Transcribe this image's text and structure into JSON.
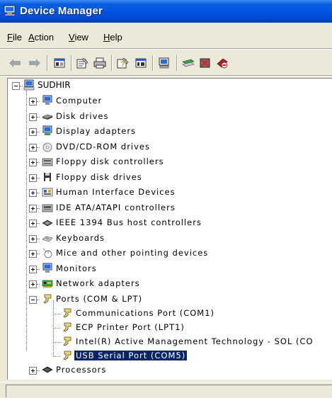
{
  "window": {
    "title": "Device Manager",
    "title_icon": "computer-icon"
  },
  "menu": [
    {
      "label": "File",
      "key": "F",
      "rest": "ile"
    },
    {
      "label": "Action",
      "key": "A",
      "rest": "ction"
    },
    {
      "label": "View",
      "key": "V",
      "rest": "iew"
    },
    {
      "label": "Help",
      "key": "H",
      "rest": "elp"
    }
  ],
  "toolbar": [
    "back-arrow-icon",
    "forward-arrow-icon",
    "show-hide-tree-icon",
    "properties-icon",
    "print-icon",
    "help-icon",
    "view-icon",
    "scan-hardware-icon",
    "update-driver-icon",
    "uninstall-icon",
    "disable-icon"
  ],
  "tree": {
    "root": "SUDHIR",
    "categories": [
      {
        "label": "Computer",
        "icon": "computer-monitor-icon"
      },
      {
        "label": "Disk drives",
        "icon": "disk-drive-icon"
      },
      {
        "label": "Display adapters",
        "icon": "display-adapter-icon"
      },
      {
        "label": "DVD/CD-ROM drives",
        "icon": "cdrom-icon"
      },
      {
        "label": "Floppy disk controllers",
        "icon": "floppy-controller-icon"
      },
      {
        "label": "Floppy disk drives",
        "icon": "floppy-drive-icon"
      },
      {
        "label": "Human Interface Devices",
        "icon": "hid-icon"
      },
      {
        "label": "IDE ATA/ATAPI controllers",
        "icon": "ide-controller-icon"
      },
      {
        "label": "IEEE 1394 Bus host controllers",
        "icon": "ieee1394-icon"
      },
      {
        "label": "Keyboards",
        "icon": "keyboard-icon"
      },
      {
        "label": "Mice and other pointing devices",
        "icon": "mouse-icon"
      },
      {
        "label": "Monitors",
        "icon": "monitor-icon"
      },
      {
        "label": "Network adapters",
        "icon": "network-adapter-icon"
      },
      {
        "label": "Ports (COM & LPT)",
        "icon": "port-icon",
        "expanded": true
      },
      {
        "label": "Processors",
        "icon": "processor-icon"
      }
    ],
    "ports_children": [
      "Communications Port (COM1)",
      "ECP Printer Port (LPT1)",
      "Intel(R) Active Management Technology - SOL (CO",
      "USB Serial Port (COM5)"
    ],
    "selected": "USB Serial Port (COM5)"
  },
  "colors": {
    "title_bar": "#0055e5",
    "selection": "#0a246a",
    "chrome": "#ece9d8"
  }
}
